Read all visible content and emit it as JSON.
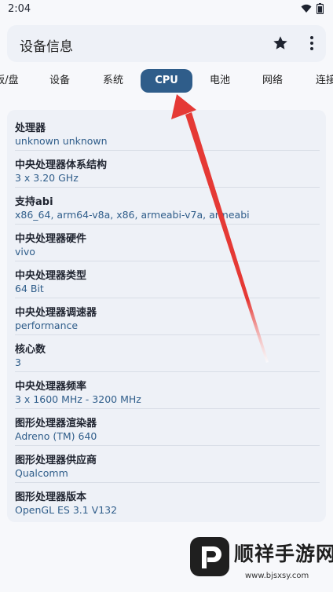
{
  "status_bar": {
    "time": "2:04"
  },
  "app_bar": {
    "title": "设备信息"
  },
  "tabs": [
    {
      "label": "主板/盘"
    },
    {
      "label": "设备"
    },
    {
      "label": "系统"
    },
    {
      "label": "CPU"
    },
    {
      "label": "电池"
    },
    {
      "label": "网络"
    },
    {
      "label": "连接"
    }
  ],
  "active_tab": "CPU",
  "cpu_info": [
    {
      "label": "处理器",
      "value": "unknown unknown"
    },
    {
      "label": "中央处理器体系结构",
      "value": "3 x 3.20 GHz"
    },
    {
      "label": "支持abi",
      "value": "x86_64, arm64-v8a, x86, armeabi-v7a, armeabi"
    },
    {
      "label": "中央处理器硬件",
      "value": "vivo"
    },
    {
      "label": "中央处理器类型",
      "value": "64 Bit"
    },
    {
      "label": "中央处理器调速器",
      "value": "performance"
    },
    {
      "label": "核心数",
      "value": "3"
    },
    {
      "label": "中央处理器频率",
      "value": "3 x 1600 MHz - 3200 MHz"
    },
    {
      "label": "图形处理器渲染器",
      "value": "Adreno (TM) 640"
    },
    {
      "label": "图形处理器供应商",
      "value": "Qualcomm"
    },
    {
      "label": "图形处理器版本",
      "value": "OpenGL ES 3.1 V132"
    }
  ],
  "watermark": {
    "title": "顺祥手游网",
    "url": "www.bjsxsy.com"
  },
  "colors": {
    "accent": "#2f5d8a",
    "annotation_arrow": "#e53935"
  }
}
